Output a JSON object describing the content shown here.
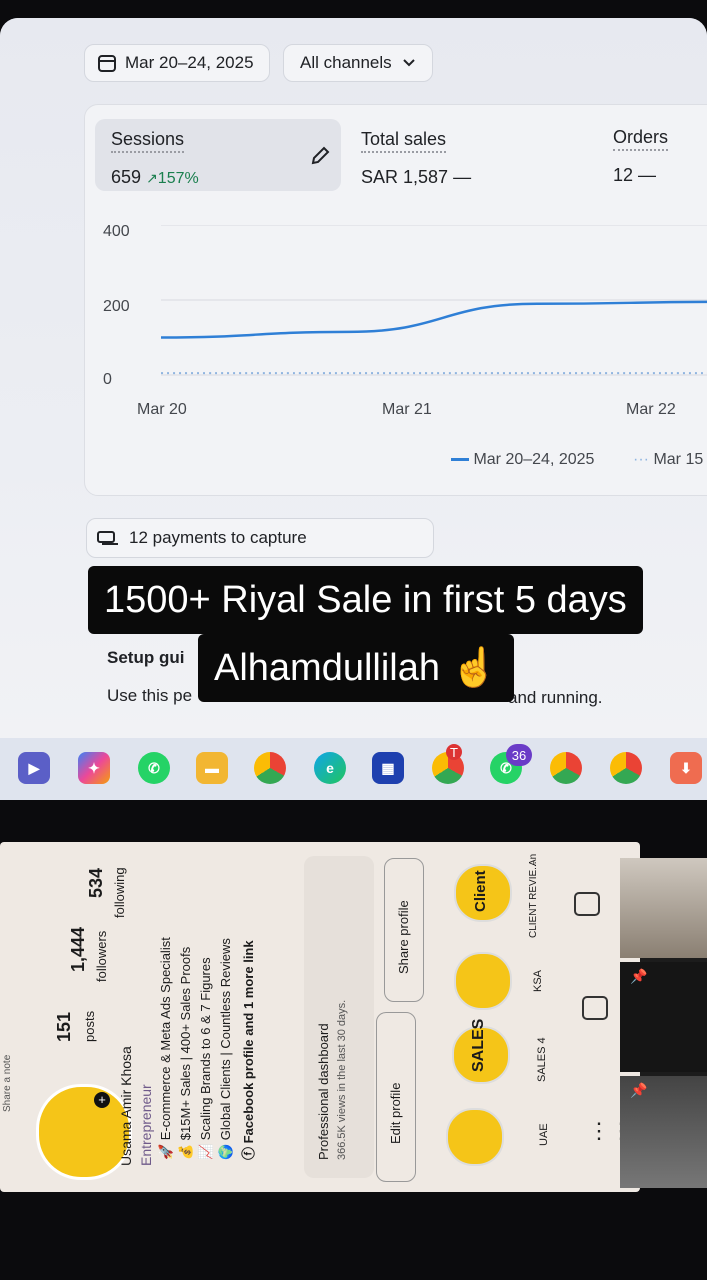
{
  "toolbar": {
    "date_range": "Mar 20–24, 2025",
    "channels": "All channels"
  },
  "metrics": [
    {
      "label": "Sessions",
      "value": "659",
      "change": "157%"
    },
    {
      "label": "Total sales",
      "value": "SAR 1,587",
      "change": "—"
    },
    {
      "label": "Orders",
      "value": "12",
      "change": "—"
    }
  ],
  "chart_data": {
    "type": "line",
    "x": [
      "Mar 20",
      "Mar 21",
      "Mar 22"
    ],
    "x_ticks": [
      "Mar 20",
      "Mar 21",
      "Mar 22"
    ],
    "y_ticks": [
      "400",
      "200",
      "0"
    ],
    "ylim": [
      0,
      400
    ],
    "grid": true,
    "legend": [
      "Mar 20–24, 2025",
      "Mar 15"
    ],
    "series": [
      {
        "name": "Mar 20–24, 2025",
        "style": "solid",
        "color": "#2f7fd6",
        "values": [
          100,
          115,
          190,
          195
        ]
      },
      {
        "name": "Mar 15",
        "style": "dotted",
        "color": "#8fb4e0",
        "values": [
          5,
          5,
          5,
          5
        ]
      }
    ]
  },
  "payments": "12 payments to capture",
  "setup": {
    "title": "Setup gui",
    "body": "Use this pe",
    "body_tail": "and running."
  },
  "caption": {
    "line1": "1500+ Riyal Sale in first 5 days",
    "line2": "Alhamdullilah ☝"
  },
  "taskbar": {
    "whatsapp_badge": "36",
    "chrome_badge": "T"
  },
  "profile": {
    "note": "Share a note",
    "stats": [
      {
        "value": "151",
        "label": "posts"
      },
      {
        "value": "1,444",
        "label": "followers"
      },
      {
        "value": "534",
        "label": "following"
      }
    ],
    "name": "Usama Amir Khosa",
    "category": "Entrepreneur",
    "bio": [
      "🚀 E-commerce & Meta Ads Specialist",
      "💰 $15M+ Sales | 400+ Sales Proofs",
      "📈 Scaling Brands to 6 & 7 Figures",
      "🌍 Global Clients | Countless Reviews",
      "ⓕ Facebook profile and 1 more link"
    ],
    "dashboard_title": "Professional dashboard",
    "dashboard_sub": "366.5K views in the last 30 days.",
    "edit_button": "Edit profile",
    "share_button": "Share profile",
    "highlights": [
      {
        "label": "UAE",
        "text": ""
      },
      {
        "label": "SALES 4",
        "text": "SALES"
      },
      {
        "label": "KSA",
        "text": ""
      },
      {
        "label": "CLIENT REVIE...",
        "text": "Client"
      },
      {
        "label": "An",
        "text": ""
      }
    ]
  },
  "colors": {
    "line": "#2f7fd6",
    "positive": "#1a7f4e",
    "caption_bg": "#0a0a0a",
    "highlight": "#f5c518"
  }
}
